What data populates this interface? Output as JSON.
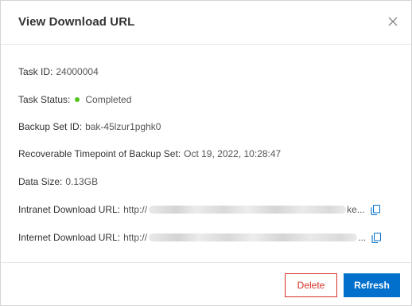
{
  "dialog": {
    "title": "View Download URL",
    "close_icon": "close-icon"
  },
  "fields": {
    "task_id": {
      "label": "Task ID",
      "sep": ":",
      "value": "24000004"
    },
    "task_status": {
      "label": "Task Status",
      "sep": ":",
      "value": "Completed",
      "dot_color": "#52c41a"
    },
    "backup_set_id": {
      "label": "Backup Set ID",
      "sep": ":",
      "value": "bak-45lzur1pghk0"
    },
    "timepoint": {
      "label": "Recoverable Timepoint of Backup Set",
      "sep": ":",
      "value": "Oct 19, 2022, 10:28:47"
    },
    "data_size": {
      "label": "Data Size",
      "sep": ":",
      "value": "0.13GB"
    },
    "intranet_url": {
      "label": "Intranet Download URL",
      "sep": ":",
      "prefix": "http://",
      "suffix": "ke...",
      "copy_icon": "copy-icon"
    },
    "internet_url": {
      "label": "Internet Download URL",
      "sep": ":",
      "prefix": "http://",
      "suffix": "...",
      "copy_icon": "copy-icon"
    }
  },
  "footer": {
    "delete_label": "Delete",
    "refresh_label": "Refresh"
  },
  "colors": {
    "primary": "#0070cc",
    "danger": "#d93026",
    "success": "#52c41a"
  }
}
